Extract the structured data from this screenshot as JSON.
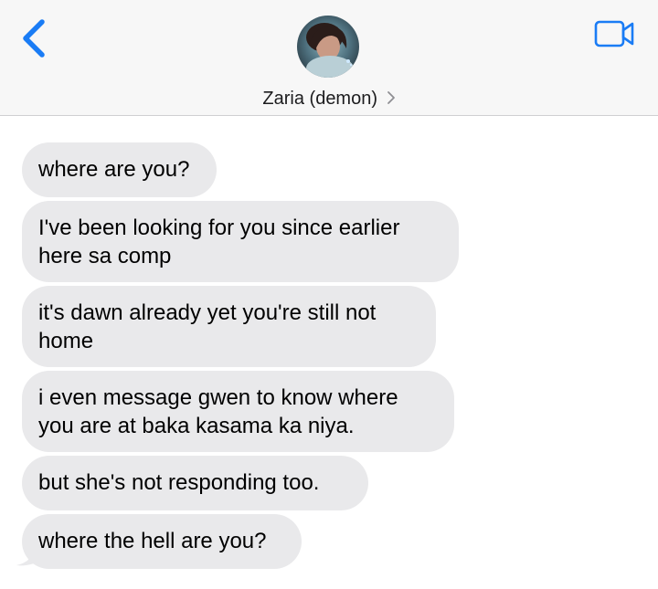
{
  "header": {
    "contact_name": "Zaria (demon)",
    "back_icon": "chevron-left-icon",
    "video_icon": "video-camera-icon",
    "accent_color": "#1a7cf5"
  },
  "messages": [
    {
      "text": "where are you?",
      "direction": "incoming"
    },
    {
      "text": "I've been looking for you since earlier here sa comp",
      "direction": "incoming"
    },
    {
      "text": "it's dawn already yet you're still not home",
      "direction": "incoming"
    },
    {
      "text": "i even message gwen to know where you are at baka kasama ka niya.",
      "direction": "incoming"
    },
    {
      "text": "but she's not responding too.",
      "direction": "incoming"
    },
    {
      "text": "where the hell are you?",
      "direction": "incoming"
    }
  ],
  "colors": {
    "incoming_bubble": "#e9e9eb",
    "header_background": "#f7f7f7"
  }
}
